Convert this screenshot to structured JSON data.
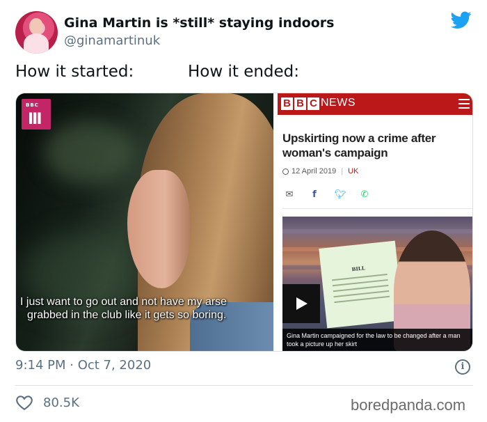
{
  "tweet": {
    "display_name": "Gina Martin is *still* staying indoors",
    "handle": "@ginamartinuk",
    "caption_left": "How it started:",
    "caption_right": "How it ended:",
    "timestamp": "9:14 PM · Oct 7, 2020",
    "like_count": "80.5K"
  },
  "media_left": {
    "channel_logo_small": "BBC",
    "channel_logo_big": "III",
    "subtitle_line1": "I just want to go out and not have my arse",
    "subtitle_line2": "grabbed in the club like it gets so boring."
  },
  "media_right": {
    "brand_letters": [
      "B",
      "B",
      "C"
    ],
    "brand_section": "NEWS",
    "headline": "Upskirting now a crime after woman's campaign",
    "date": "12 April 2019",
    "region": "UK",
    "share_icons": [
      "mail-icon",
      "facebook-icon",
      "twitter-icon",
      "whatsapp-icon"
    ],
    "document_title": "BILL",
    "video_caption": "Gina Martin campaigned for the law to be changed after a man took a picture up her skirt"
  },
  "watermark": "boredpanda.com",
  "colors": {
    "twitter_blue": "#1da1f2",
    "bbc_red": "#bb1919",
    "bbc_three_pink": "#c32666",
    "muted_text": "#5b7083"
  }
}
